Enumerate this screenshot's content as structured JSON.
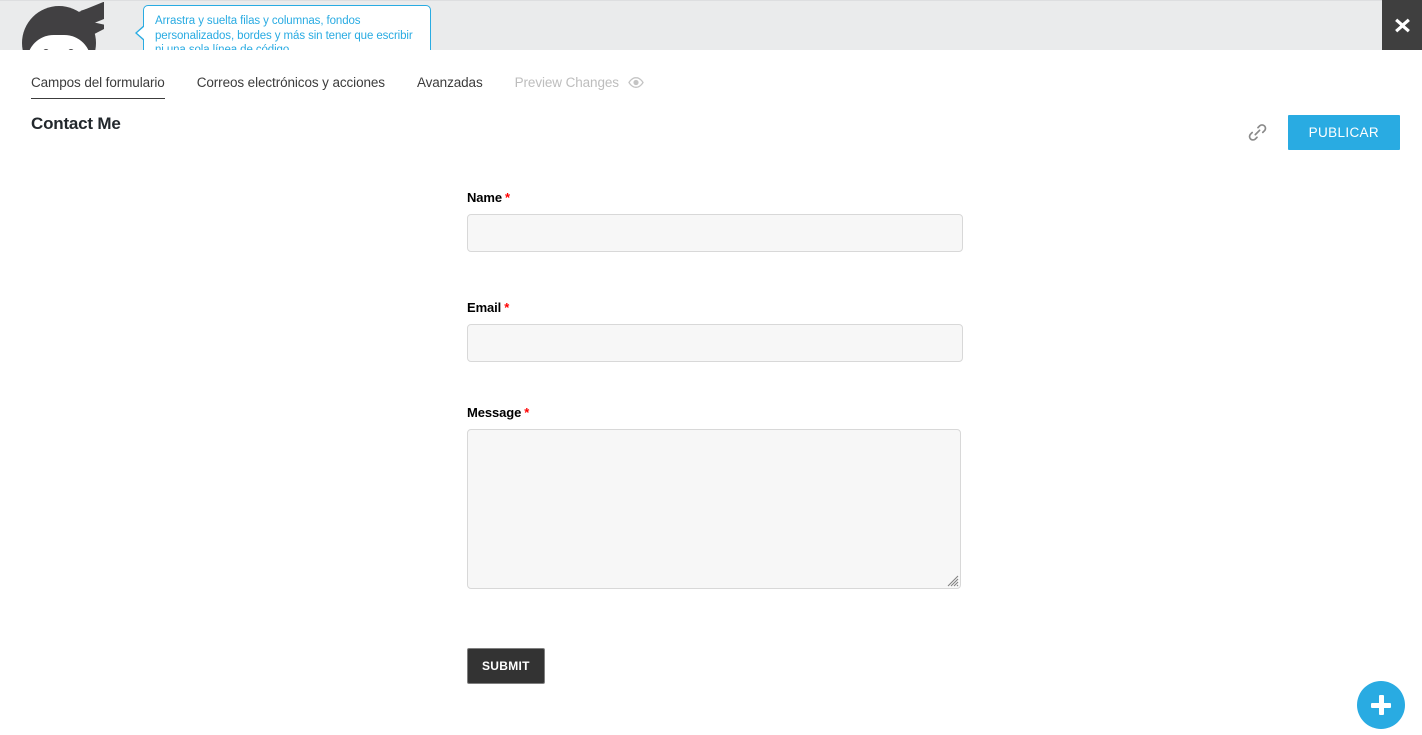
{
  "topbar": {
    "logo_name": "ninja-forms-logo",
    "tooltip_text": "Arrastra y suelta filas y columnas, fondos\npersonalizados, bordes y más sin tener que escribir\nni una sola línea de código.",
    "close_label": "✖",
    "accent_color": "#29abe2",
    "background_color": "#eaebec"
  },
  "tabs": [
    {
      "label": "Campos del formulario",
      "state": "active"
    },
    {
      "label": "Correos electrónicos y acciones",
      "state": "default"
    },
    {
      "label": "Avanzadas",
      "state": "default"
    },
    {
      "label": "Preview Changes",
      "state": "disabled",
      "icon": "eye-icon"
    }
  ],
  "actions": {
    "link_icon": "link-icon",
    "publish_label": "PUBLICAR",
    "publish_color": "#29abe2"
  },
  "page": {
    "title": "Contact Me"
  },
  "form": {
    "required_marker": "*",
    "fields": [
      {
        "label": "Name",
        "type": "text",
        "value": "",
        "placeholder": "",
        "required": true
      },
      {
        "label": "Email",
        "type": "text",
        "value": "",
        "placeholder": "",
        "required": true
      },
      {
        "label": "Message",
        "type": "textarea",
        "value": "",
        "placeholder": "",
        "required": true
      }
    ],
    "submit_label": "SUBMIT",
    "submit_color": "#333333"
  },
  "fab": {
    "icon": "plus-icon",
    "color": "#29abe2"
  }
}
